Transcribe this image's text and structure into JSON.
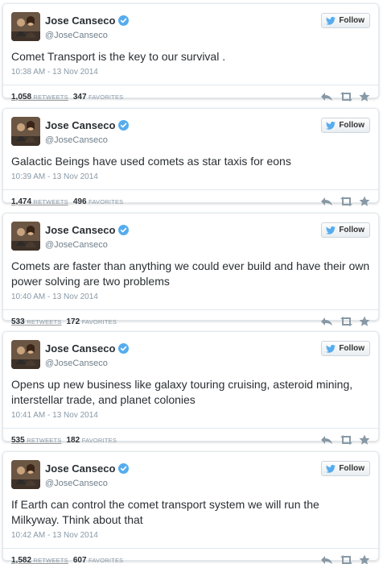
{
  "follow_label": "Follow",
  "stats_labels": {
    "retweets": "RETWEETS",
    "favorites": "FAVORITES"
  },
  "tweets": [
    {
      "name": "Jose Canseco",
      "handle": "@JoseCanseco",
      "text": "Comet Transport is the key to our survival .",
      "timestamp": "10:38 AM - 13 Nov 2014",
      "retweets": "1,058",
      "favorites": "347"
    },
    {
      "name": "Jose Canseco",
      "handle": "@JoseCanseco",
      "text": "Galactic Beings have used comets as star taxis for eons",
      "timestamp": "10:39 AM - 13 Nov 2014",
      "retweets": "1,474",
      "favorites": "496"
    },
    {
      "name": "Jose Canseco",
      "handle": "@JoseCanseco",
      "text": "Comets are faster than anything we could ever build and have their own power solving are two problems",
      "timestamp": "10:40 AM - 13 Nov 2014",
      "retweets": "533",
      "favorites": "172"
    },
    {
      "name": "Jose Canseco",
      "handle": "@JoseCanseco",
      "text": "Opens up new business like galaxy touring cruising, asteroid mining, interstellar trade, and planet colonies",
      "timestamp": "10:41 AM - 13 Nov 2014",
      "retweets": "535",
      "favorites": "182"
    },
    {
      "name": "Jose Canseco",
      "handle": "@JoseCanseco",
      "text": "If Earth can control the comet transport system we will run the Milkyway. Think about that",
      "timestamp": "10:42 AM - 13 Nov 2014",
      "retweets": "1,582",
      "favorites": "607"
    }
  ],
  "colors": {
    "verified": "#55acee",
    "twitter_bird": "#55acee",
    "action_icon": "#8899a6"
  }
}
